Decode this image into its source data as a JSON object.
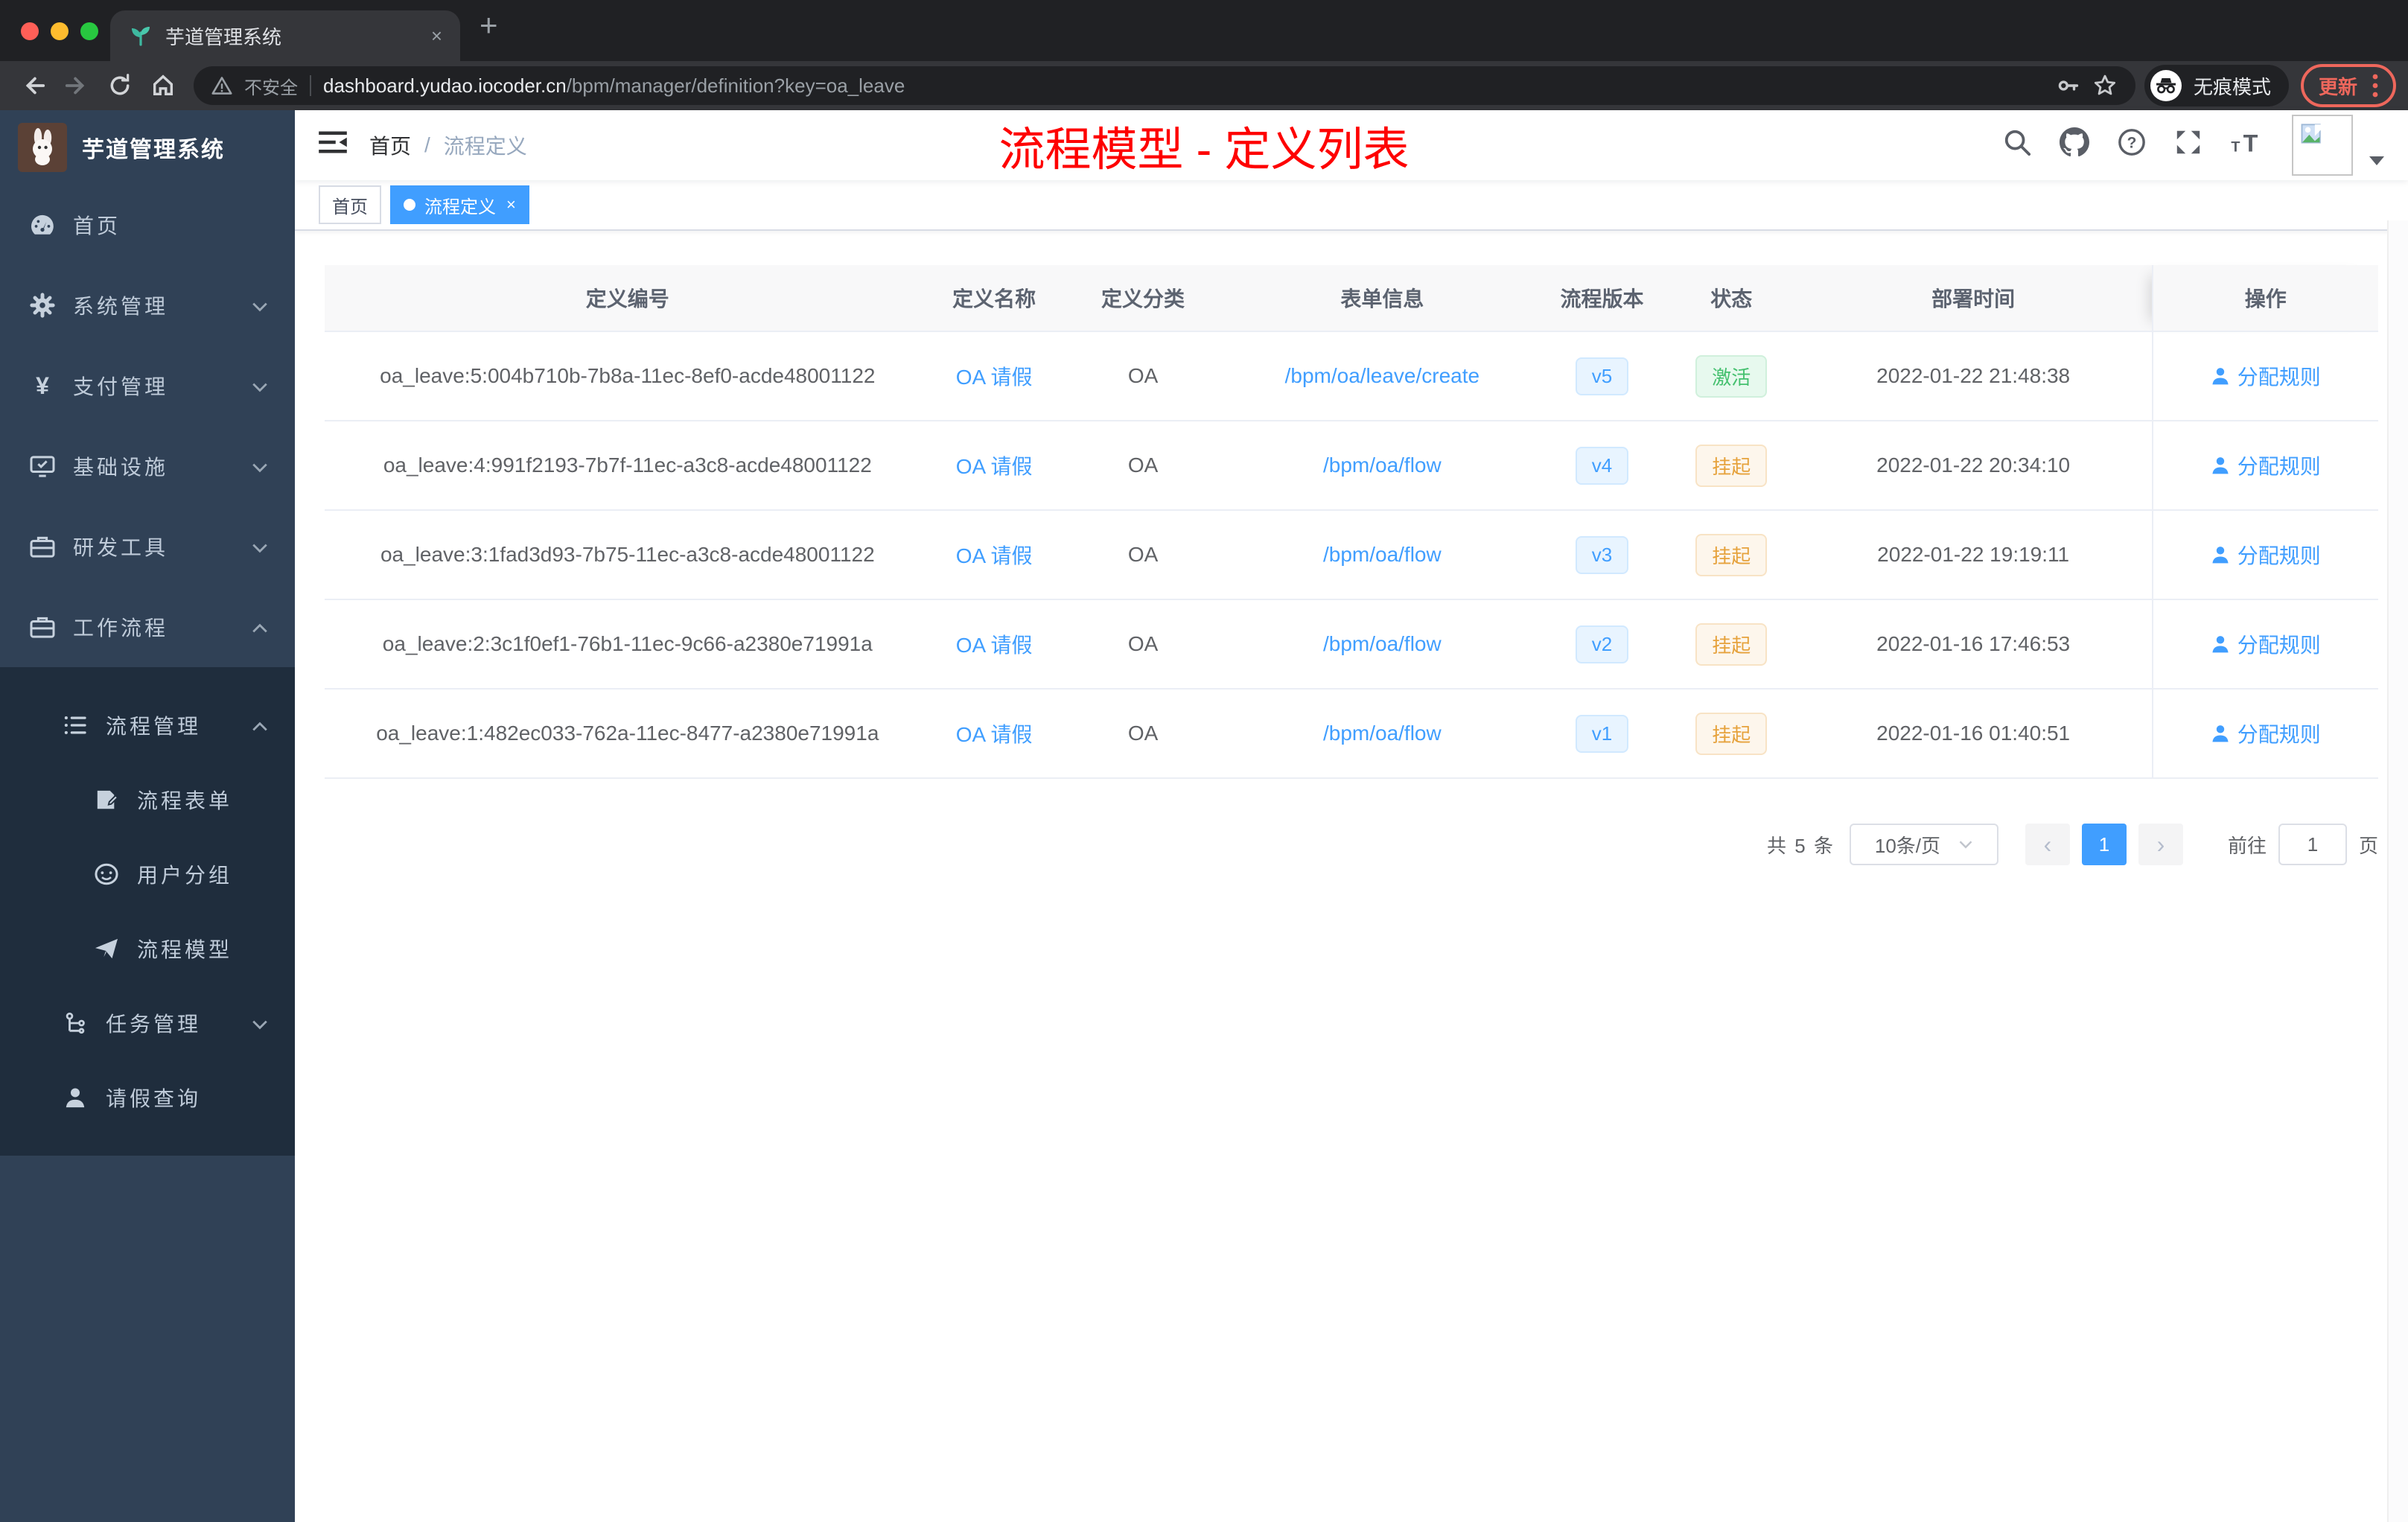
{
  "browser": {
    "tab_title": "芋道管理系统",
    "tab_close": "×",
    "new_tab": "+",
    "security_label": "不安全",
    "url_host": "dashboard.yudao.iocoder.cn",
    "url_path": "/bpm/manager/definition?key=oa_leave",
    "incognito_label": "无痕模式",
    "update_label": "更新"
  },
  "sidebar": {
    "app_title": "芋道管理系统",
    "menu": [
      {
        "label": "首页"
      },
      {
        "label": "系统管理"
      },
      {
        "label": "支付管理"
      },
      {
        "label": "基础设施"
      },
      {
        "label": "研发工具"
      },
      {
        "label": "工作流程"
      },
      {
        "label": "流程管理"
      },
      {
        "label": "流程表单"
      },
      {
        "label": "用户分组"
      },
      {
        "label": "流程模型"
      },
      {
        "label": "任务管理"
      },
      {
        "label": "请假查询"
      }
    ]
  },
  "navbar": {
    "breadcrumb_home": "首页",
    "breadcrumb_sep": "/",
    "breadcrumb_current": "流程定义",
    "annotation": "流程模型 - 定义列表"
  },
  "tags": [
    {
      "label": "首页"
    },
    {
      "label": "流程定义",
      "close": "×"
    }
  ],
  "table": {
    "columns": [
      "定义编号",
      "定义名称",
      "定义分类",
      "表单信息",
      "流程版本",
      "状态",
      "部署时间",
      "操作"
    ],
    "rows": [
      {
        "id": "oa_leave:5:004b710b-7b8a-11ec-8ef0-acde48001122",
        "name": "OA 请假",
        "category": "OA",
        "form": "/bpm/oa/leave/create",
        "version": "v5",
        "status": "激活",
        "status_type": "success",
        "deployed_at": "2022-01-22 21:48:38",
        "action": "分配规则"
      },
      {
        "id": "oa_leave:4:991f2193-7b7f-11ec-a3c8-acde48001122",
        "name": "OA 请假",
        "category": "OA",
        "form": "/bpm/oa/flow",
        "version": "v4",
        "status": "挂起",
        "status_type": "warning",
        "deployed_at": "2022-01-22 20:34:10",
        "action": "分配规则"
      },
      {
        "id": "oa_leave:3:1fad3d93-7b75-11ec-a3c8-acde48001122",
        "name": "OA 请假",
        "category": "OA",
        "form": "/bpm/oa/flow",
        "version": "v3",
        "status": "挂起",
        "status_type": "warning",
        "deployed_at": "2022-01-22 19:19:11",
        "action": "分配规则"
      },
      {
        "id": "oa_leave:2:3c1f0ef1-76b1-11ec-9c66-a2380e71991a",
        "name": "OA 请假",
        "category": "OA",
        "form": "/bpm/oa/flow",
        "version": "v2",
        "status": "挂起",
        "status_type": "warning",
        "deployed_at": "2022-01-16 17:46:53",
        "action": "分配规则"
      },
      {
        "id": "oa_leave:1:482ec033-762a-11ec-8477-a2380e71991a",
        "name": "OA 请假",
        "category": "OA",
        "form": "/bpm/oa/flow",
        "version": "v1",
        "status": "挂起",
        "status_type": "warning",
        "deployed_at": "2022-01-16 01:40:51",
        "action": "分配规则"
      }
    ]
  },
  "pagination": {
    "total": "共 5 条",
    "page_size": "10条/页",
    "prev": "‹",
    "current": "1",
    "next": "›",
    "goto_label": "前往",
    "goto_value": "1",
    "unit_label": "页"
  },
  "colors": {
    "accent": "#409eff",
    "annotation": "#fe0000",
    "sidebar_bg": "#304156",
    "submenu_bg": "#1f2d3d",
    "status_active": "#44c06e",
    "status_suspended": "#e6a23c",
    "update_button": "#ee675c"
  }
}
